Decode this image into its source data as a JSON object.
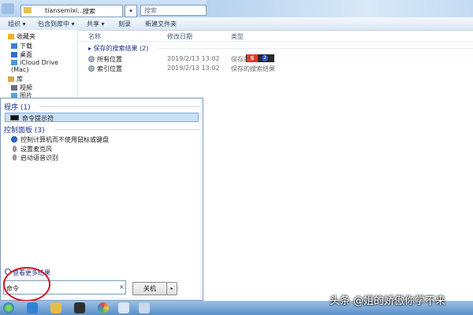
{
  "explorer": {
    "address": {
      "crumb1": "tiansemixi...",
      "crumb2": "搜索"
    },
    "search_placeholder": "搜索",
    "toolbar": {
      "organize": "组织 ▾",
      "include_in_library": "包含到库中 ▾",
      "share": "共享 ▾",
      "burn": "刻录",
      "new_folder": "新建文件夹"
    },
    "nav": {
      "items": [
        {
          "label": "收藏夹"
        },
        {
          "label": "下载"
        },
        {
          "label": "桌面"
        },
        {
          "label": "iCloud Drive (Mac)"
        },
        {
          "label": "库"
        },
        {
          "label": "视频"
        },
        {
          "label": "图片"
        }
      ]
    },
    "columns": {
      "name": "名称",
      "modified": "修改日期",
      "type": "类型"
    },
    "group_header": "▸ 保存的搜索结果 (2)",
    "rows": [
      {
        "name": "所有位置",
        "date": "2019/2/13 13:02",
        "type": "保存的"
      },
      {
        "name": "索引位置",
        "date": "2019/2/13 13:02",
        "type": "保存的搜索结果"
      }
    ],
    "ime": {
      "s": "S",
      "b": "2"
    }
  },
  "start_menu": {
    "programs_header": "程序 (1)",
    "programs": [
      {
        "label": "命令提示符"
      }
    ],
    "control_panel_header": "控制面板 (3)",
    "control_panel_items": [
      {
        "label": "控制计算机而不使用鼠标或键盘"
      },
      {
        "label": "设置麦克风"
      },
      {
        "label": "启动语音识别"
      }
    ],
    "see_more": "查看更多结果",
    "search_value": "命令",
    "clear": "×",
    "shutdown_label": "关机",
    "shutdown_arrow": "▸"
  },
  "watermark": "头条 @姐的娇傲你学不来",
  "colors": {
    "accent": "#1e3287",
    "highlight": "#c7e0f6",
    "annotation": "#d4141e"
  }
}
